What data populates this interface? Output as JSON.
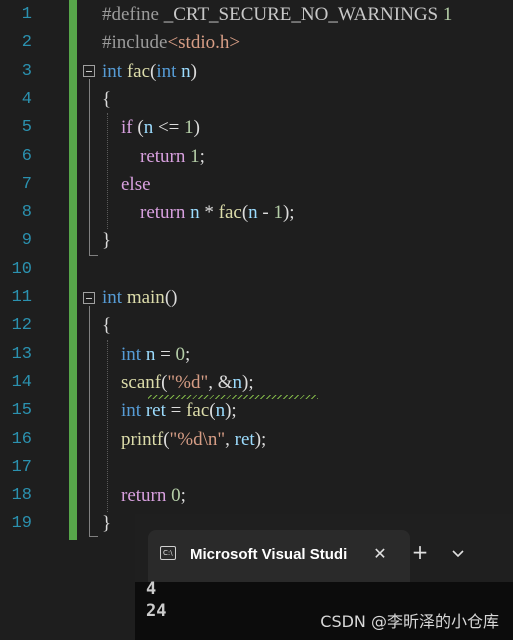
{
  "editor": {
    "line_numbers": [
      "1",
      "2",
      "3",
      "4",
      "5",
      "6",
      "7",
      "8",
      "9",
      "10",
      "11",
      "12",
      "13",
      "14",
      "15",
      "16",
      "17",
      "18",
      "19"
    ],
    "lines": [
      [
        {
          "c": "pre",
          "t": "#define "
        },
        {
          "c": "mac",
          "t": "_CRT_SECURE_NO_WARNINGS"
        },
        {
          "c": "num",
          "t": " 1"
        }
      ],
      [
        {
          "c": "pre",
          "t": "#include"
        },
        {
          "c": "inc",
          "t": "<stdio.h>"
        }
      ],
      [
        {
          "c": "kw",
          "t": "int"
        },
        {
          "c": "",
          "t": " "
        },
        {
          "c": "fn",
          "t": "fac"
        },
        {
          "c": "",
          "t": "("
        },
        {
          "c": "kw",
          "t": "int"
        },
        {
          "c": "",
          "t": " "
        },
        {
          "c": "var",
          "t": "n"
        },
        {
          "c": "",
          "t": ")"
        }
      ],
      [
        {
          "c": "",
          "t": "{"
        }
      ],
      [
        {
          "c": "",
          "t": "    "
        },
        {
          "c": "kw2",
          "t": "if"
        },
        {
          "c": "",
          "t": " ("
        },
        {
          "c": "var",
          "t": "n"
        },
        {
          "c": "",
          "t": " <= "
        },
        {
          "c": "num",
          "t": "1"
        },
        {
          "c": "",
          "t": ")"
        }
      ],
      [
        {
          "c": "",
          "t": "        "
        },
        {
          "c": "kw2",
          "t": "return"
        },
        {
          "c": "",
          "t": " "
        },
        {
          "c": "num",
          "t": "1"
        },
        {
          "c": "",
          "t": ";"
        }
      ],
      [
        {
          "c": "",
          "t": "    "
        },
        {
          "c": "kw2",
          "t": "else"
        }
      ],
      [
        {
          "c": "",
          "t": "        "
        },
        {
          "c": "kw2",
          "t": "return"
        },
        {
          "c": "",
          "t": " "
        },
        {
          "c": "var",
          "t": "n"
        },
        {
          "c": "",
          "t": " * "
        },
        {
          "c": "fn",
          "t": "fac"
        },
        {
          "c": "",
          "t": "("
        },
        {
          "c": "var",
          "t": "n"
        },
        {
          "c": "",
          "t": " - "
        },
        {
          "c": "num",
          "t": "1"
        },
        {
          "c": "",
          "t": ");"
        }
      ],
      [
        {
          "c": "",
          "t": "}"
        }
      ],
      [],
      [
        {
          "c": "kw",
          "t": "int"
        },
        {
          "c": "",
          "t": " "
        },
        {
          "c": "fn",
          "t": "main"
        },
        {
          "c": "",
          "t": "()"
        }
      ],
      [
        {
          "c": "",
          "t": "{"
        }
      ],
      [
        {
          "c": "",
          "t": "    "
        },
        {
          "c": "kw",
          "t": "int"
        },
        {
          "c": "",
          "t": " "
        },
        {
          "c": "var",
          "t": "n"
        },
        {
          "c": "",
          "t": " = "
        },
        {
          "c": "num",
          "t": "0"
        },
        {
          "c": "",
          "t": ";"
        }
      ],
      [
        {
          "c": "",
          "t": "    "
        },
        {
          "c": "fn",
          "t": "scanf"
        },
        {
          "c": "",
          "t": "("
        },
        {
          "c": "str",
          "t": "\"%d\""
        },
        {
          "c": "",
          "t": ", &"
        },
        {
          "c": "var",
          "t": "n"
        },
        {
          "c": "",
          "t": ");"
        }
      ],
      [
        {
          "c": "",
          "t": "    "
        },
        {
          "c": "kw",
          "t": "int"
        },
        {
          "c": "",
          "t": " "
        },
        {
          "c": "var",
          "t": "ret"
        },
        {
          "c": "",
          "t": " = "
        },
        {
          "c": "fn",
          "t": "fac"
        },
        {
          "c": "",
          "t": "("
        },
        {
          "c": "var",
          "t": "n"
        },
        {
          "c": "",
          "t": ");"
        }
      ],
      [
        {
          "c": "",
          "t": "    "
        },
        {
          "c": "fn",
          "t": "printf"
        },
        {
          "c": "",
          "t": "("
        },
        {
          "c": "str",
          "t": "\"%d\\n\""
        },
        {
          "c": "",
          "t": ", "
        },
        {
          "c": "var",
          "t": "ret"
        },
        {
          "c": "",
          "t": ");"
        }
      ],
      [],
      [
        {
          "c": "",
          "t": "    "
        },
        {
          "c": "kw2",
          "t": "return"
        },
        {
          "c": "",
          "t": " "
        },
        {
          "c": "num",
          "t": "0"
        },
        {
          "c": "",
          "t": ";"
        }
      ],
      [
        {
          "c": "",
          "t": "}"
        }
      ]
    ],
    "colors": {
      "background": "#1e1e1e",
      "line_number": "#2b91af",
      "keyword": "#569cd6",
      "control_keyword": "#d8a0df",
      "function": "#dcdcaa",
      "variable": "#9cdcfe",
      "number": "#b5cea8",
      "string": "#d69d85",
      "change_bar": "#57a64a"
    }
  },
  "terminal": {
    "tab_icon_name": "terminal-icon",
    "tab_icon_text": "C:\\",
    "tab_title": "Microsoft Visual Studi",
    "close_glyph": "✕",
    "new_tab_glyph": "+",
    "output": [
      "4",
      "24"
    ]
  },
  "watermark": "CSDN @李昕泽的小仓库"
}
